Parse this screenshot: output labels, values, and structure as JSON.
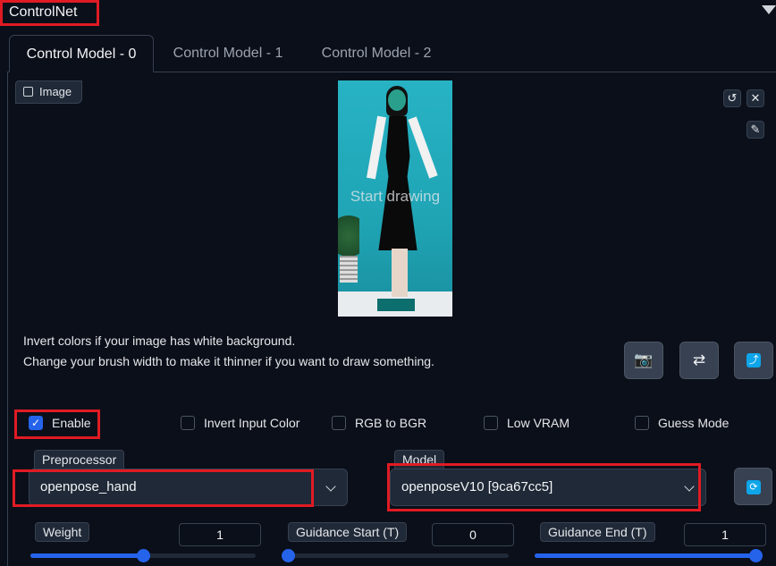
{
  "header": {
    "title": "ControlNet"
  },
  "tabs": [
    {
      "label": "Control Model - 0",
      "active": true
    },
    {
      "label": "Control Model - 1",
      "active": false
    },
    {
      "label": "Control Model - 2",
      "active": false
    }
  ],
  "image_panel": {
    "label": "Image",
    "placeholder": "Start drawing"
  },
  "hints": {
    "line1": "Invert colors if your image has white background.",
    "line2": "Change your brush width to make it thinner if you want to draw something."
  },
  "checkboxes": {
    "enable": {
      "label": "Enable",
      "checked": true
    },
    "invert": {
      "label": "Invert Input Color",
      "checked": false
    },
    "rgb": {
      "label": "RGB to BGR",
      "checked": false
    },
    "lowvram": {
      "label": "Low VRAM",
      "checked": false
    },
    "guess": {
      "label": "Guess Mode",
      "checked": false
    }
  },
  "preprocessor": {
    "label": "Preprocessor",
    "value": "openpose_hand"
  },
  "model": {
    "label": "Model",
    "value": "openposeV10 [9ca67cc5]"
  },
  "sliders": {
    "weight": {
      "label": "Weight",
      "value": "1",
      "fraction": 0.5
    },
    "guidance_start": {
      "label": "Guidance Start (T)",
      "value": "0",
      "fraction": 0.0
    },
    "guidance_end": {
      "label": "Guidance End (T)",
      "value": "1",
      "fraction": 1.0
    }
  },
  "colors": {
    "accent": "#2563eb",
    "highlight": "#e01b24",
    "background": "#0b0f19"
  }
}
